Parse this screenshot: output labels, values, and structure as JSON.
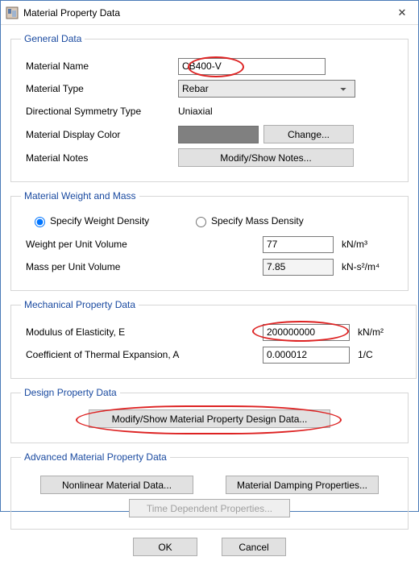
{
  "window": {
    "title": "Material Property Data"
  },
  "general": {
    "legend": "General Data",
    "material_name_label": "Material Name",
    "material_name_value": "CB400-V",
    "material_type_label": "Material Type",
    "material_type_value": "Rebar",
    "symmetry_label": "Directional Symmetry Type",
    "symmetry_value": "Uniaxial",
    "display_color_label": "Material Display Color",
    "change_btn": "Change...",
    "notes_label": "Material Notes",
    "notes_btn": "Modify/Show Notes..."
  },
  "weight_mass": {
    "legend": "Material Weight and Mass",
    "radio_weight": "Specify Weight Density",
    "radio_mass": "Specify Mass Density",
    "wpuv_label": "Weight per Unit Volume",
    "wpuv_value": "77",
    "wpuv_unit": "kN/m³",
    "mpuv_label": "Mass per Unit Volume",
    "mpuv_value": "7.85",
    "mpuv_unit": "kN-s²/m⁴"
  },
  "mech": {
    "legend": "Mechanical Property Data",
    "mod_e_label": "Modulus of Elasticity,  E",
    "mod_e_value": "200000000",
    "mod_e_unit": "kN/m²",
    "thermal_label": "Coefficient of Thermal Expansion,  A",
    "thermal_value": "0.000012",
    "thermal_unit": "1/C"
  },
  "design": {
    "legend": "Design Property Data",
    "design_btn": "Modify/Show Material Property Design Data..."
  },
  "advanced": {
    "legend": "Advanced Material Property Data",
    "nonlinear_btn": "Nonlinear Material Data...",
    "damping_btn": "Material Damping Properties...",
    "time_btn": "Time Dependent Properties..."
  },
  "footer": {
    "ok": "OK",
    "cancel": "Cancel"
  }
}
